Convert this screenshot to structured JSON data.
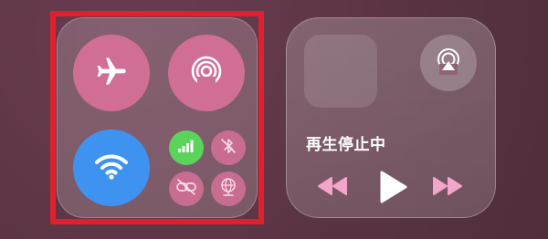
{
  "connectivity": {
    "airplane_mode": {
      "icon": "airplane-icon",
      "active": true
    },
    "airdrop": {
      "icon": "airdrop-icon",
      "active": true
    },
    "wifi": {
      "icon": "wifi-icon",
      "active": true
    },
    "cellular": {
      "icon": "cellular-signal-icon",
      "active": true
    },
    "bluetooth": {
      "icon": "bluetooth-off-icon",
      "active": false
    },
    "hotspot": {
      "icon": "personal-hotspot-icon",
      "active": false
    },
    "vpn": {
      "icon": "vpn-globe-icon",
      "active": false
    }
  },
  "now_playing": {
    "status": "再生停止中",
    "controls": {
      "airplay": "airplay-icon",
      "rewind": "rewind-icon",
      "play": "play-icon",
      "forward": "fast-forward-icon"
    }
  },
  "colors": {
    "background": "#5b3444",
    "selection_outline": "#e1202b",
    "pink_toggle": "#d06e96",
    "wifi_blue": "#3f93f0",
    "cellular_green": "#5bd45c",
    "media_pink": "#f4a6c8"
  }
}
